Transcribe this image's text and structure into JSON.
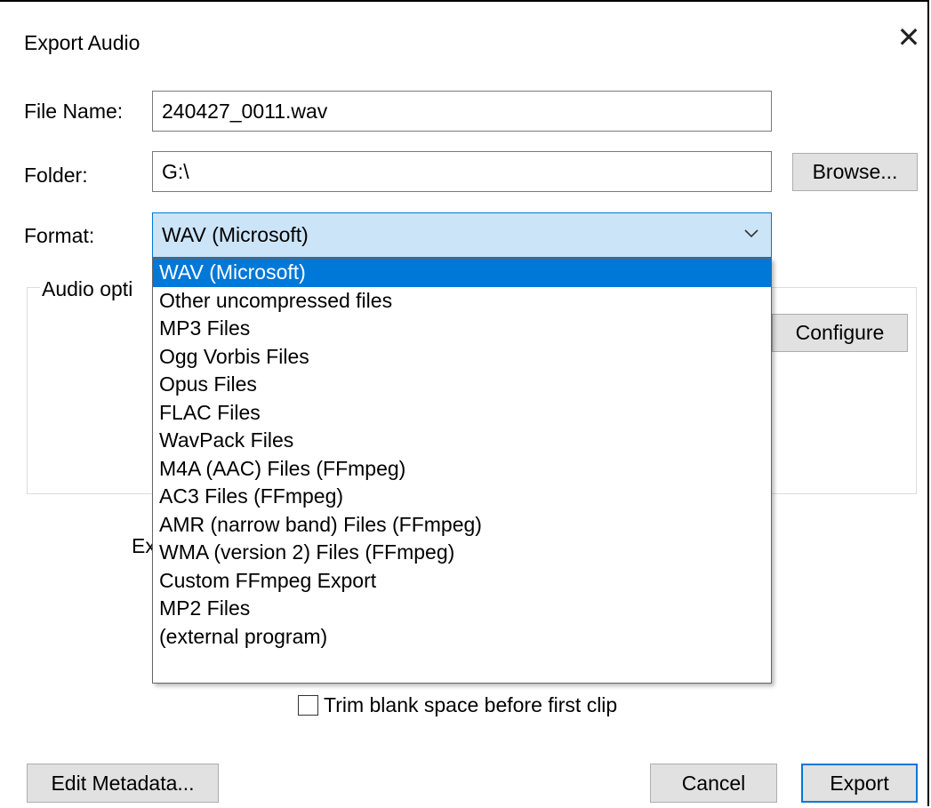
{
  "dialog": {
    "title": "Export Audio",
    "close_icon": "close-icon"
  },
  "file_name": {
    "label": "File Name:",
    "value": "240427_0011.wav"
  },
  "folder": {
    "label": "Folder:",
    "value": "G:\\",
    "browse_label": "Browse..."
  },
  "format": {
    "label": "Format:",
    "selected": "WAV (Microsoft)",
    "options": [
      "WAV (Microsoft)",
      "Other uncompressed files",
      "MP3 Files",
      "Ogg Vorbis Files",
      "Opus Files",
      "FLAC Files",
      "WavPack Files",
      "M4A (AAC) Files (FFmpeg)",
      "AC3 Files (FFmpeg)",
      "AMR (narrow band) Files (FFmpeg)",
      "WMA (version 2) Files (FFmpeg)",
      "Custom FFmpeg Export",
      "MP2 Files",
      "(external program)"
    ]
  },
  "audio_options": {
    "label": "Audio opti",
    "configure_label": "Configure"
  },
  "hidden_label_fragment": "Ex",
  "trim": {
    "label": "Trim blank space before first clip",
    "checked": false
  },
  "footer": {
    "edit_metadata_label": "Edit Metadata...",
    "cancel_label": "Cancel",
    "export_label": "Export"
  },
  "colors": {
    "accent": "#0078d7",
    "selection_bg": "#cce4f7"
  }
}
